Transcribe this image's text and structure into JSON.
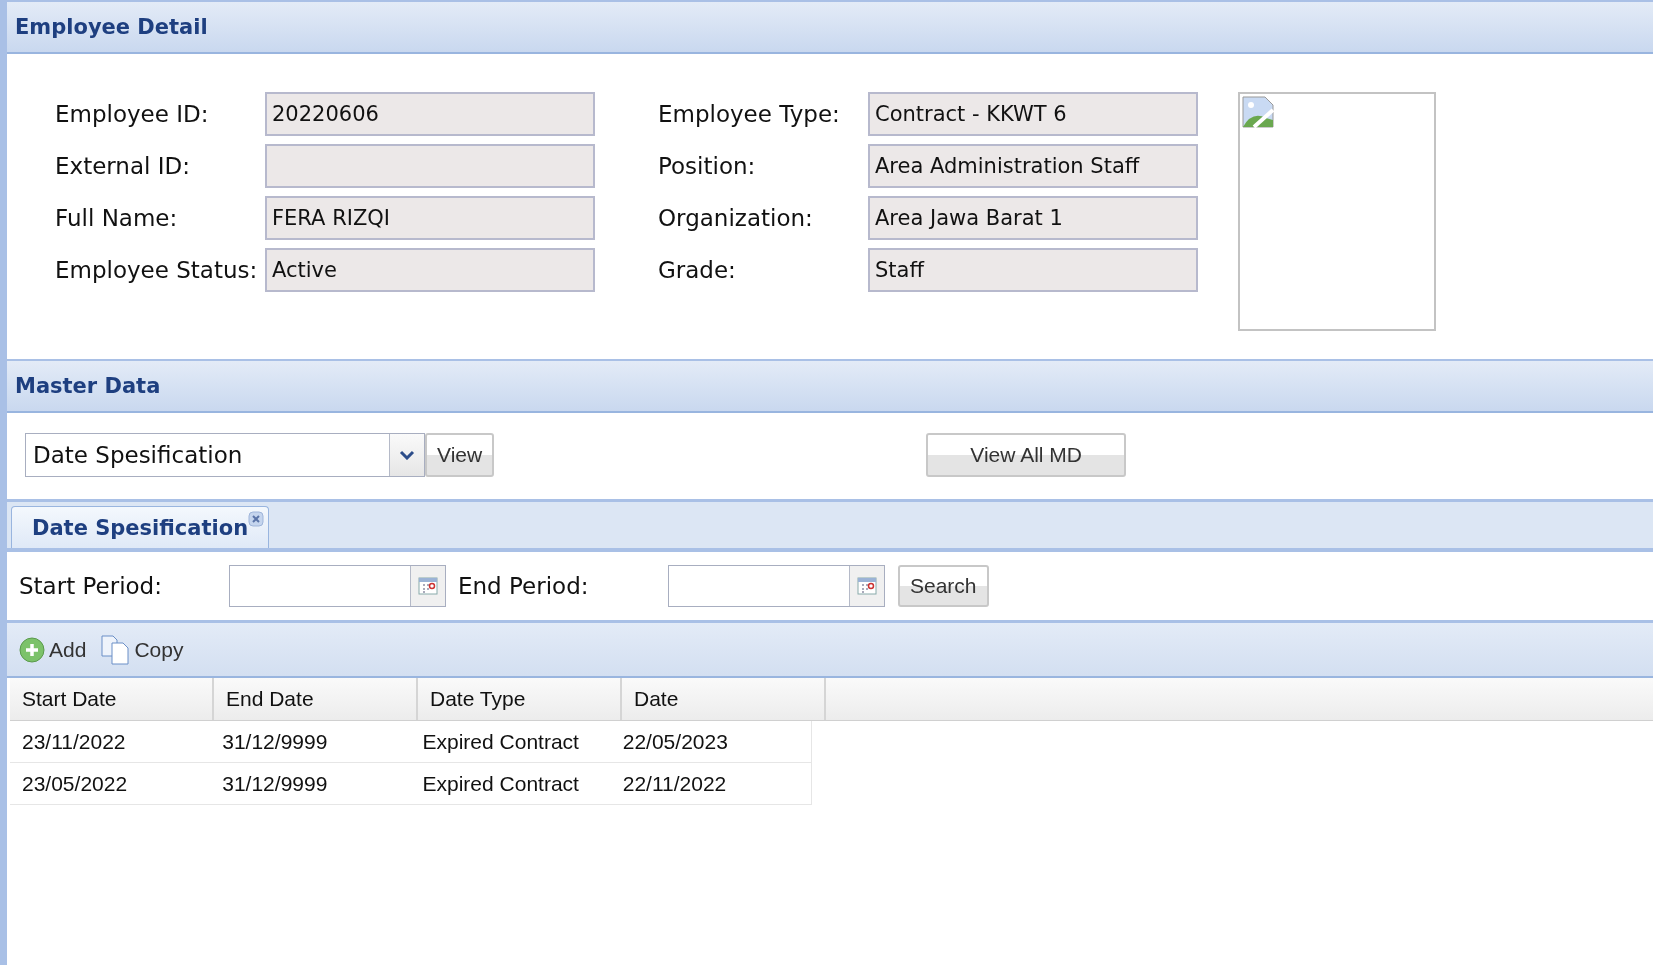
{
  "employee_detail": {
    "title": "Employee Detail",
    "left_fields": [
      {
        "label": "Employee ID:",
        "value": "20220606"
      },
      {
        "label": "External ID:"
      },
      {
        "label": "Full Name:",
        "value": "FERA RIZQI"
      },
      {
        "label": "Employee Status:",
        "value": "Active"
      }
    ],
    "right_fields": [
      {
        "label": "Employee Type:",
        "value": "Contract - KKWT 6"
      },
      {
        "label": "Position:",
        "value": "Area Administration Staff"
      },
      {
        "label": "Organization:",
        "value": "Area Jawa Barat 1"
      },
      {
        "label": "Grade:",
        "value": "Staff"
      }
    ],
    "photo": {
      "kind": "broken"
    }
  },
  "master_data": {
    "title": "Master Data",
    "select": {
      "value": "Date Spesification"
    },
    "view_button": "View",
    "view_all_button": "View All MD"
  },
  "tabs": [
    {
      "label": "Date Spesification",
      "selected": true
    }
  ],
  "filter": {
    "start_label": "Start Period:",
    "end_label": "End Period:",
    "search_button": "Search"
  },
  "toolbar": [
    {
      "kind": "add",
      "label": "Add"
    },
    {
      "kind": "copy",
      "label": "Copy"
    }
  ],
  "table": {
    "columns": [
      "Start Date",
      "End Date",
      "Date Type",
      "Date"
    ],
    "rows": [
      [
        "23/11/2022",
        "31/12/9999",
        "Expired Contract",
        "22/05/2023"
      ],
      [
        "23/05/2022",
        "31/12/9999",
        "Expired Contract",
        "22/11/2022"
      ]
    ]
  }
}
